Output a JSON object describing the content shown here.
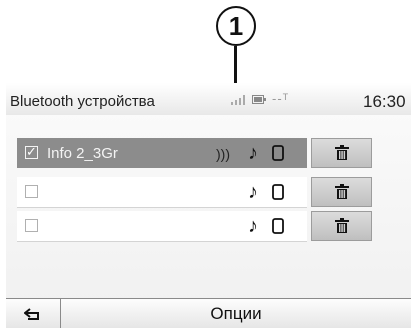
{
  "callout": {
    "number": "1"
  },
  "header": {
    "title": "Bluetooth устройства",
    "network_status": "--ᵀ",
    "clock": "16:30"
  },
  "devices": [
    {
      "name": "Info 2_3Gr",
      "checked": true,
      "selected": true,
      "icons": [
        "audio-stream-icon",
        "music-icon",
        "phone-icon",
        "trash-icon"
      ]
    },
    {
      "name": "",
      "checked": false,
      "selected": false,
      "icons": [
        "music-icon",
        "phone-icon",
        "trash-icon"
      ]
    },
    {
      "name": "",
      "checked": false,
      "selected": false,
      "icons": [
        "music-icon",
        "phone-icon",
        "trash-icon"
      ]
    }
  ],
  "footer": {
    "back_icon": "back-arrow-icon",
    "options_label": "Опции"
  },
  "colors": {
    "selected_row": "#8c8c8c",
    "button_face": "#cfcfcf",
    "screen_bg": "#f4f4f4"
  }
}
